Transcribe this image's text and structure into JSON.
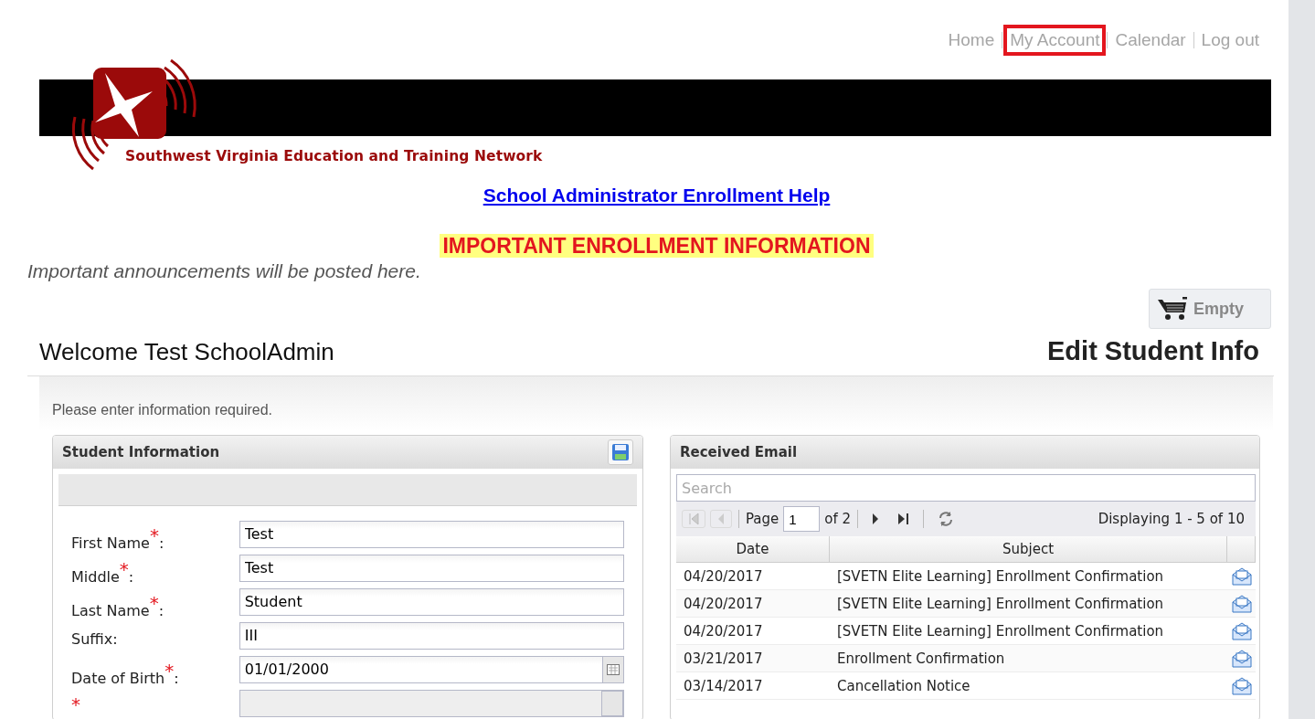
{
  "nav": [
    {
      "label": "Home",
      "highlighted": false
    },
    {
      "label": "My Account",
      "highlighted": true
    },
    {
      "label": "Calendar",
      "highlighted": false
    },
    {
      "label": "Log out",
      "highlighted": false
    }
  ],
  "logo": {
    "tagline": "Southwest Virginia Education and Training Network"
  },
  "help_link": "School Administrator Enrollment Help",
  "notice": {
    "title": "IMPORTANT ENROLLMENT INFORMATION",
    "text": "Important announcements will be posted here."
  },
  "cart": {
    "label": "Empty"
  },
  "welcome": "Welcome Test SchoolAdmin",
  "page_title": "Edit Student Info",
  "instructions": "Please enter information required.",
  "student_panel": {
    "title": "Student Information",
    "required_mark": "*",
    "fields": [
      {
        "label": "First Name",
        "required": true,
        "colon": ":",
        "value": "Test",
        "kind": "text"
      },
      {
        "label": "Middle",
        "required": true,
        "colon": ":",
        "value": "Test",
        "kind": "text"
      },
      {
        "label": "Last Name",
        "required": true,
        "colon": ":",
        "value": "Student",
        "kind": "text"
      },
      {
        "label": "Suffix",
        "required": false,
        "colon": ":",
        "value": "III",
        "kind": "text"
      },
      {
        "label": "Date of Birth",
        "required": true,
        "colon": ":",
        "value": "01/01/2000",
        "kind": "date"
      },
      {
        "required": true,
        "kind": "select"
      }
    ]
  },
  "email_panel": {
    "title": "Received Email",
    "search": {
      "placeholder": "Search"
    },
    "pager": {
      "page_label": "Page",
      "page": "1",
      "of": "of 2",
      "display": "Displaying 1 - 5 of 10"
    },
    "columns": [
      "Date",
      "Subject"
    ],
    "rows": [
      {
        "date": "04/20/2017",
        "subject": "[SVETN Elite Learning] Enrollment Confirmation"
      },
      {
        "date": "04/20/2017",
        "subject": "[SVETN Elite Learning] Enrollment Confirmation"
      },
      {
        "date": "04/20/2017",
        "subject": "[SVETN Elite Learning] Enrollment Confirmation"
      },
      {
        "date": "03/21/2017",
        "subject": "Enrollment Confirmation"
      },
      {
        "date": "03/14/2017",
        "subject": "Cancellation Notice"
      }
    ]
  }
}
